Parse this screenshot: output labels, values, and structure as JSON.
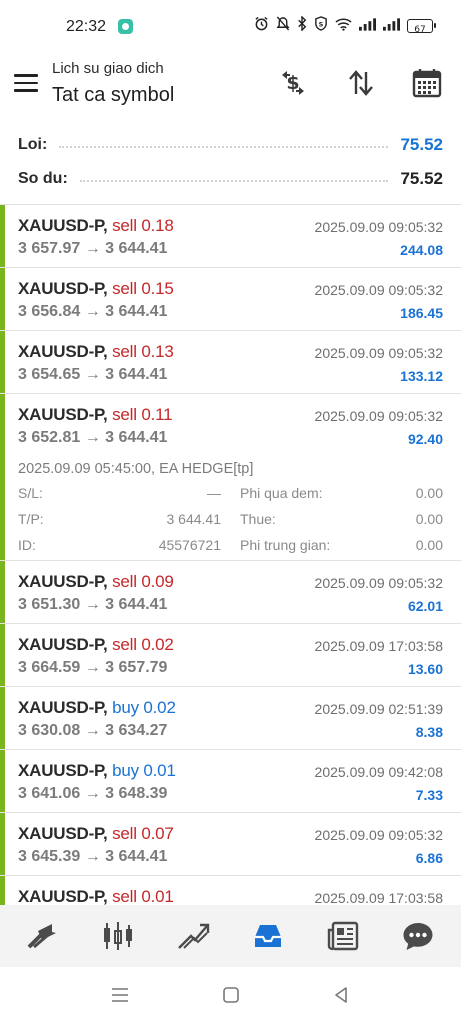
{
  "status_bar": {
    "time": "22:32",
    "battery": "67",
    "icons": [
      "alarm-icon",
      "mute-icon",
      "bluetooth-icon",
      "shield-icon",
      "wifi-icon",
      "signal-icon",
      "signal-icon",
      "battery-icon"
    ]
  },
  "header": {
    "subtitle": "Lich su giao dich",
    "title": "Tat ca symbol",
    "actions": [
      "currency-exchange-icon",
      "sort-icon",
      "calendar-icon"
    ]
  },
  "summary": {
    "profit_label": "Loi:",
    "profit_value": "75.52",
    "balance_label": "So du:",
    "balance_value": "75.52"
  },
  "colors": {
    "accent_blue": "#1a73d4",
    "sell_red": "#c5282a",
    "deal_bar_green": "#7ab51d"
  },
  "deals": [
    {
      "symbol": "XAUUSD-P,",
      "type": "sell",
      "volume": "0.18",
      "time": "2025.09.09 09:05:32",
      "prices": "3 657.97 → 3 644.41",
      "profit": "244.08"
    },
    {
      "symbol": "XAUUSD-P,",
      "type": "sell",
      "volume": "0.15",
      "time": "2025.09.09 09:05:32",
      "prices": "3 656.84 → 3 644.41",
      "profit": "186.45"
    },
    {
      "symbol": "XAUUSD-P,",
      "type": "sell",
      "volume": "0.13",
      "time": "2025.09.09 09:05:32",
      "prices": "3 654.65 → 3 644.41",
      "profit": "133.12"
    },
    {
      "symbol": "XAUUSD-P,",
      "type": "sell",
      "volume": "0.11",
      "time": "2025.09.09 09:05:32",
      "prices": "3 652.81 → 3 644.41",
      "profit": "92.40"
    },
    {
      "symbol": "XAUUSD-P,",
      "type": "sell",
      "volume": "0.09",
      "time": "2025.09.09 09:05:32",
      "prices": "3 651.30 → 3 644.41",
      "profit": "62.01"
    },
    {
      "symbol": "XAUUSD-P,",
      "type": "sell",
      "volume": "0.02",
      "time": "2025.09.09 17:03:58",
      "prices": "3 664.59 → 3 657.79",
      "profit": "13.60"
    },
    {
      "symbol": "XAUUSD-P,",
      "type": "buy",
      "volume": "0.02",
      "time": "2025.09.09 02:51:39",
      "prices": "3 630.08 → 3 634.27",
      "profit": "8.38"
    },
    {
      "symbol": "XAUUSD-P,",
      "type": "buy",
      "volume": "0.01",
      "time": "2025.09.09 09:42:08",
      "prices": "3 641.06 → 3 648.39",
      "profit": "7.33"
    },
    {
      "symbol": "XAUUSD-P,",
      "type": "sell",
      "volume": "0.07",
      "time": "2025.09.09 09:05:32",
      "prices": "3 645.39 → 3 644.41",
      "profit": "6.86"
    },
    {
      "symbol": "XAUUSD-P,",
      "type": "sell",
      "volume": "0.01",
      "time": "2025.09.09 17:03:58",
      "prices": "",
      "profit": ""
    }
  ],
  "expanded_deal": {
    "comment": "2025.09.09 05:45:00, EA HEDGE[tp]",
    "sl_label": "S/L:",
    "sl_value": "—",
    "swap_label": "Phi qua dem:",
    "swap_value": "0.00",
    "tp_label": "T/P:",
    "tp_value": "3 644.41",
    "tax_label": "Thue:",
    "tax_value": "0.00",
    "id_label": "ID:",
    "id_value": "45576721",
    "commission_label": "Phi trung gian:",
    "commission_value": "0.00"
  },
  "bottom_nav": {
    "items": [
      "quotes-icon",
      "chart-icon",
      "trade-icon",
      "history-icon",
      "news-icon",
      "messages-icon"
    ],
    "active": "history-icon"
  },
  "system_nav": [
    "recent-apps-icon",
    "home-icon",
    "back-icon"
  ]
}
